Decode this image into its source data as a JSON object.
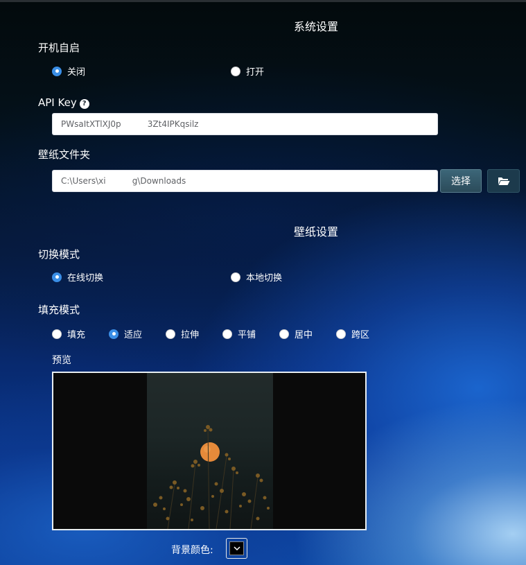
{
  "system_settings": {
    "title": "系统设置",
    "autostart": {
      "label": "开机自启",
      "options": [
        {
          "label": "关闭",
          "selected": true
        },
        {
          "label": "打开",
          "selected": false
        }
      ]
    },
    "api_key": {
      "label": "API Key",
      "help_icon": "question-circle-icon",
      "value": "PWsaItXTlXJ0p          3Zt4IPKqsilz"
    },
    "wallpaper_folder": {
      "label": "壁纸文件夹",
      "value": "C:\\Users\\xi          g\\Downloads",
      "select_button": "选择",
      "open_folder_icon": "folder-open-icon"
    }
  },
  "wallpaper_settings": {
    "title": "壁纸设置",
    "switch_mode": {
      "label": "切换模式",
      "options": [
        {
          "label": "在线切换",
          "selected": true
        },
        {
          "label": "本地切换",
          "selected": false
        }
      ]
    },
    "fill_mode": {
      "label": "填充模式",
      "options": [
        {
          "label": "填充",
          "selected": false
        },
        {
          "label": "适应",
          "selected": true
        },
        {
          "label": "拉伸",
          "selected": false
        },
        {
          "label": "平铺",
          "selected": false
        },
        {
          "label": "居中",
          "selected": false
        },
        {
          "label": "跨区",
          "selected": false
        }
      ]
    },
    "preview": {
      "label": "预览"
    },
    "background_color": {
      "label": "背景颜色:",
      "value": "#000000",
      "dropdown_icon": "chevron-down-icon"
    }
  }
}
